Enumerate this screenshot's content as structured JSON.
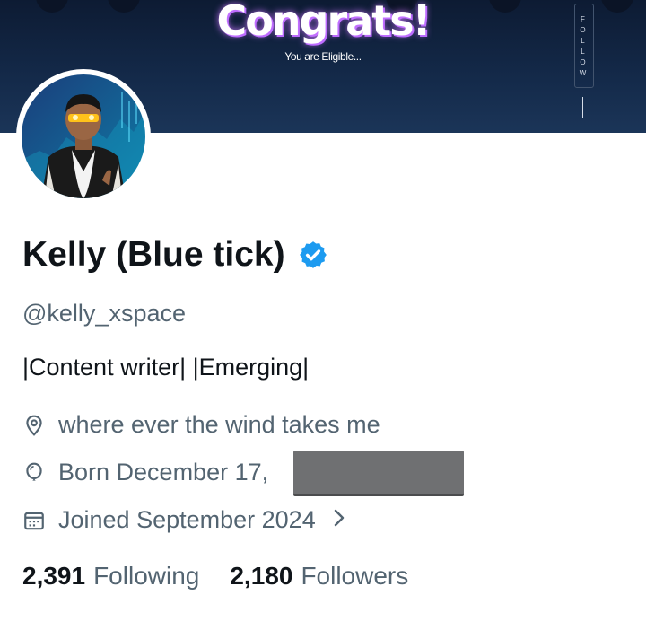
{
  "banner": {
    "title": "Congrats!",
    "subtitle": "You are Eligible...",
    "side_label": "FOLLOW"
  },
  "profile": {
    "name": "Kelly (Blue tick)",
    "verified": true,
    "handle": "@kelly_xspace",
    "bio": "|Content writer| |Emerging|",
    "location": "where ever the wind takes me",
    "birthday": "Born December 17,",
    "joined": "Joined September 2024"
  },
  "stats": {
    "following_count": "2,391",
    "following_label": "Following",
    "followers_count": "2,180",
    "followers_label": "Followers"
  },
  "colors": {
    "verified": "#1d9bf0",
    "secondary_text": "#536471",
    "primary_text": "#0f1419"
  },
  "icons": {
    "location": "location-pin-icon",
    "birthday": "balloon-icon",
    "joined": "calendar-icon",
    "chevron": "chevron-right-icon",
    "verified": "verified-badge-icon"
  }
}
